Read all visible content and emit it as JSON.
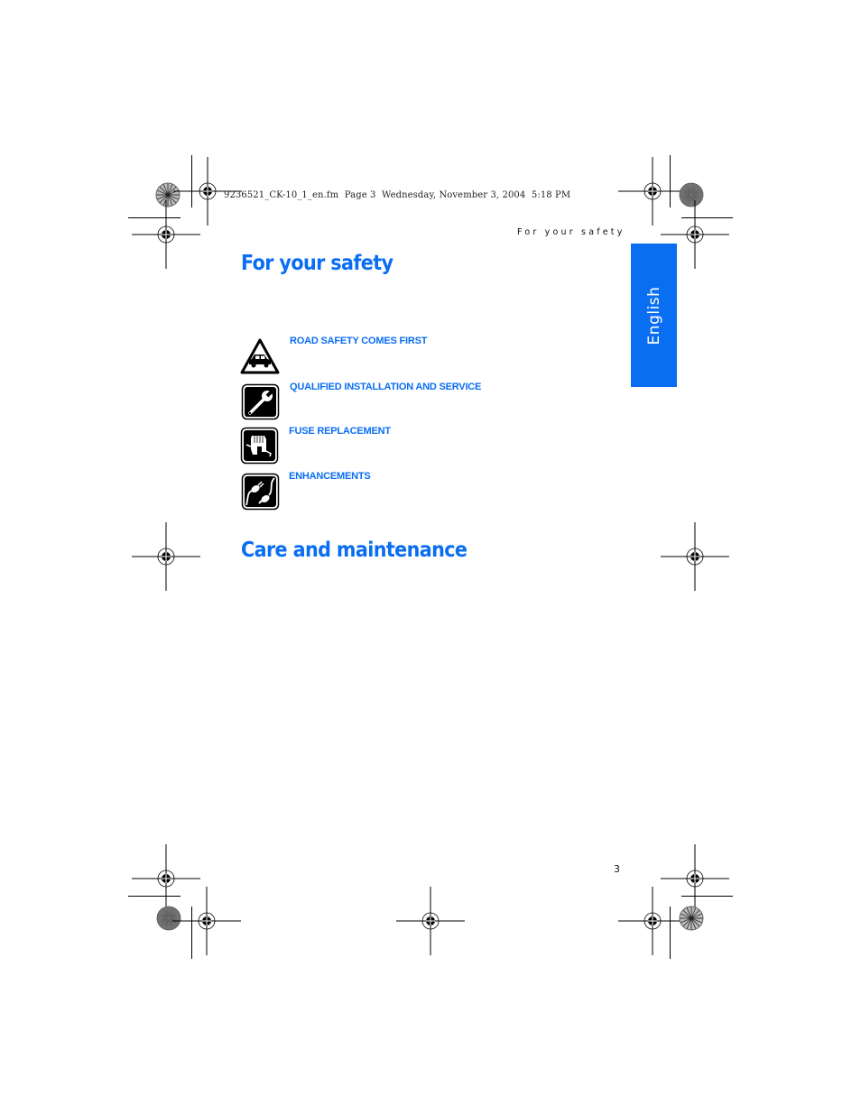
{
  "slug": {
    "file_name": "9236521_CK-10_1_en.fm",
    "page_label": "Page 3",
    "date": "Wednesday, November 3, 2004",
    "time": "5:18 PM"
  },
  "running_head": "For your safety",
  "language_tab": "English",
  "sections": [
    {
      "title": "For your safety",
      "items": [
        {
          "icon": "road-safety-car-icon",
          "label": "ROAD SAFETY COMES FIRST"
        },
        {
          "icon": "wrench-icon",
          "label": "QUALIFIED INSTALLATION AND SERVICE"
        },
        {
          "icon": "fuse-icon",
          "label": "FUSE REPLACEMENT"
        },
        {
          "icon": "plug-enhancements-icon",
          "label": "ENHANCEMENTS"
        }
      ]
    },
    {
      "title": "Care and maintenance",
      "items": []
    }
  ],
  "page_number": "3",
  "colors": {
    "accent": "#0a6ef2",
    "text": "#111111"
  }
}
